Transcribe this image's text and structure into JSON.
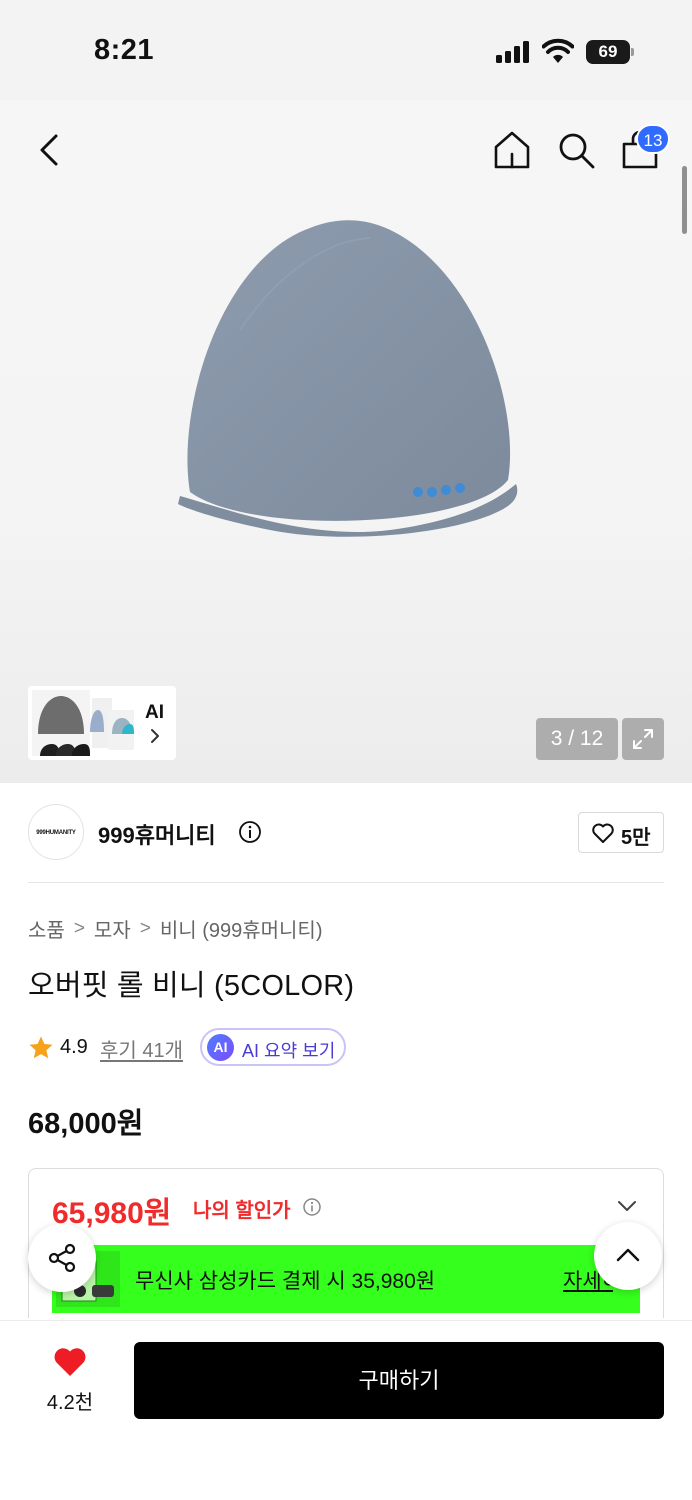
{
  "status_bar": {
    "time": "8:21",
    "battery": "69"
  },
  "header": {
    "cart_count": "13"
  },
  "gallery": {
    "page_counter": "3 / 12",
    "ai_label": "AI"
  },
  "brand": {
    "logo_text": "999HUMANITY",
    "name": "999휴머니티",
    "like_count": "5만"
  },
  "breadcrumb": [
    "소품",
    "모자",
    "비니 (999휴머니티)"
  ],
  "breadcrumb_separator": ">",
  "product": {
    "title": "오버핏 롤 비니 (5COLOR)"
  },
  "rating": {
    "value": "4.9",
    "reviews_label": "후기 41개",
    "ai_badge": "AI",
    "ai_summary_label": "AI 요약 보기"
  },
  "price": {
    "original": "68,000원",
    "sale": "65,980원",
    "sale_label": "나의 할인가",
    "card_banner_text": "무신사 삼성카드 결제 시 35,980원",
    "card_banner_link": "자세히"
  },
  "bottom_bar": {
    "wish_count": "4.2천",
    "buy_label": "구매하기"
  },
  "colors": {
    "sale": "#ef2b2b",
    "banner": "#35ff1c",
    "badge": "#2f6bff",
    "heart": "#ee1c25"
  }
}
